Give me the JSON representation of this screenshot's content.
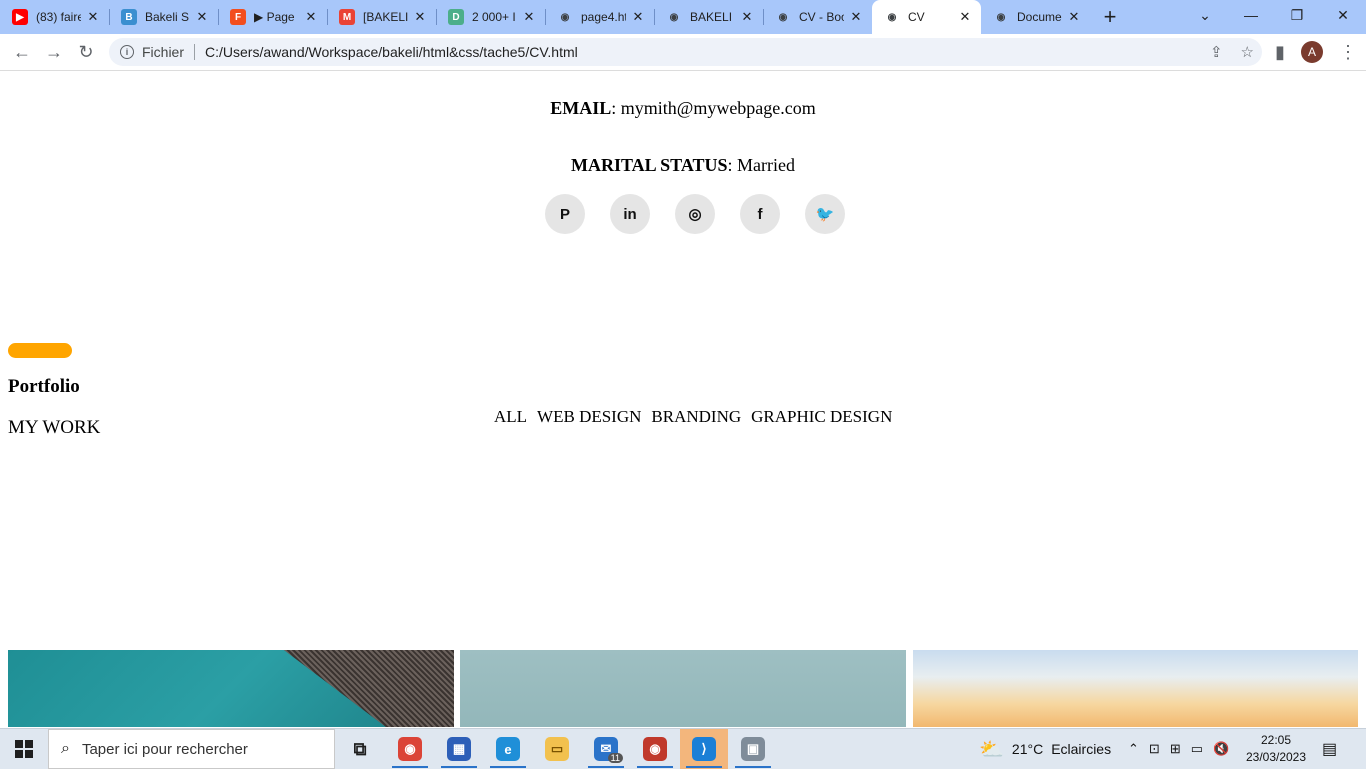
{
  "browser": {
    "tabs": [
      {
        "title": "(83) faire",
        "favicon": "youtube-icon",
        "color": "#ff0000",
        "glyph": "▶"
      },
      {
        "title": "Bakeli SI",
        "favicon": "bakeli-icon",
        "color": "#3b8fd0",
        "glyph": "B"
      },
      {
        "title": "▶ Page",
        "favicon": "figma-icon",
        "color": "#f24e1e",
        "glyph": "F"
      },
      {
        "title": "[BAKELI]",
        "favicon": "gmail-icon",
        "color": "#ea4335",
        "glyph": "M"
      },
      {
        "title": "2 000+ I",
        "favicon": "dribbble-icon",
        "color": "#4cae8a",
        "glyph": "D"
      },
      {
        "title": "page4.ht",
        "favicon": "globe-icon",
        "color": "#5f6368",
        "glyph": "◉"
      },
      {
        "title": "BAKELI",
        "favicon": "globe-icon",
        "color": "#5f6368",
        "glyph": "◉"
      },
      {
        "title": "CV - Boo",
        "favicon": "globe-icon",
        "color": "#5f6368",
        "glyph": "◉"
      },
      {
        "title": "CV",
        "favicon": "globe-icon",
        "color": "#5f6368",
        "glyph": "◉",
        "active": true
      },
      {
        "title": "Docume",
        "favicon": "globe-icon",
        "color": "#5f6368",
        "glyph": "◉"
      }
    ],
    "new_tab": "+",
    "address": {
      "scheme_label": "Fichier",
      "url": "C:/Users/awand/Workspace/bakeli/html&css/tache5/CV.html"
    },
    "profile_initial": "A"
  },
  "page": {
    "email_label": "EMAIL",
    "email_value": ": mymith@mywebpage.com",
    "marital_label": "MARITAL STATUS",
    "marital_value": ": Married",
    "socials": [
      {
        "name": "pinterest-icon",
        "glyph": "P"
      },
      {
        "name": "linkedin-icon",
        "glyph": "in"
      },
      {
        "name": "instagram-icon",
        "glyph": "◎"
      },
      {
        "name": "facebook-icon",
        "glyph": "f"
      },
      {
        "name": "twitter-icon",
        "glyph": "🐦"
      }
    ],
    "accent_color": "#ffa500",
    "portfolio_title": "Portfolio",
    "portfolio_subtitle": "MY WORK",
    "filters": [
      "ALL",
      "WEB DESIGN",
      "BRANDING",
      "GRAPHIC DESIGN"
    ]
  },
  "taskbar": {
    "search_placeholder": "Taper ici pour rechercher",
    "apps": [
      {
        "name": "task-view-icon",
        "glyph": "⧉",
        "color": "#1f1f1f",
        "bg": "transparent"
      },
      {
        "name": "chrome-icon",
        "glyph": "◉",
        "color": "#ffffff",
        "bg": "#db4437"
      },
      {
        "name": "store-icon",
        "glyph": "▦",
        "color": "#ffffff",
        "bg": "#2d5fb8"
      },
      {
        "name": "edge-icon",
        "glyph": "e",
        "color": "#ffffff",
        "bg": "#1f8fd8"
      },
      {
        "name": "file-explorer-icon",
        "glyph": "▭",
        "color": "#7a5200",
        "bg": "#f2c14e"
      },
      {
        "name": "mail-icon",
        "glyph": "✉",
        "color": "#ffffff",
        "bg": "#2a73c9"
      },
      {
        "name": "chrome-profile-icon",
        "glyph": "◉",
        "color": "#ffffff",
        "bg": "#c0392b"
      },
      {
        "name": "vscode-icon",
        "glyph": "⟩",
        "color": "#ffffff",
        "bg": "#1b7fd6"
      },
      {
        "name": "photos-icon",
        "glyph": "▣",
        "color": "#ffffff",
        "bg": "#7f8c99"
      }
    ],
    "mail_badge": "11",
    "weather": {
      "temp": "21°C",
      "condition": "Eclaircies"
    },
    "time": "22:05",
    "date": "23/03/2023"
  }
}
